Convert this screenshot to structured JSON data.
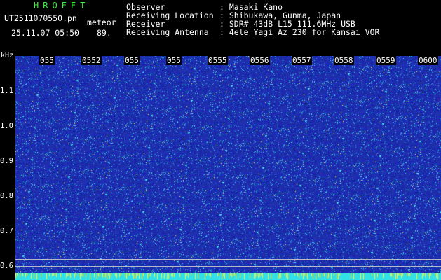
{
  "header": {
    "app_title": "HROFFT",
    "filename": "UT2511070550.pn",
    "mode": "meteor",
    "datetime": "25.11.07 05:50",
    "level": "89.",
    "fields": [
      {
        "label": "Observer",
        "value": ": Masaki Kano"
      },
      {
        "label": "Receiving Location",
        "value": ": Shibukawa, Gunma, Japan"
      },
      {
        "label": "Receiver",
        "value": ": SDR# 43dB L15 111.6MHz USB"
      },
      {
        "label": "Receiving Antenna",
        "value": ": 4ele Yagi Az 230 for Kansai VOR"
      }
    ]
  },
  "y_axis": {
    "unit": "kHz",
    "ticks": [
      "1.1",
      "1.0",
      "0.9",
      "0.8",
      "0.7",
      "0.6"
    ]
  },
  "x_axis": {
    "ticks": [
      "055",
      "0552",
      "055",
      "055",
      "0555",
      "0556",
      "0557",
      "0558",
      "0559",
      "0600"
    ]
  },
  "colors": {
    "background": "#000000",
    "noise_base": "#1c2fa8",
    "speckle_cyan": "#33e0e6",
    "speckle_yellow": "#f2f03c",
    "title_green": "#3cf03c"
  }
}
